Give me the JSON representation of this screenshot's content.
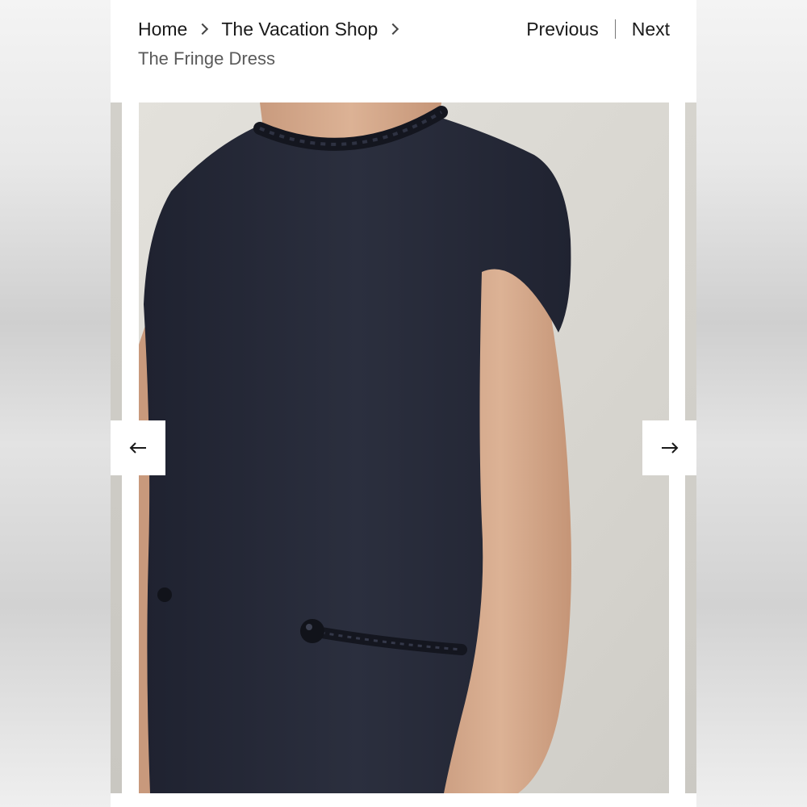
{
  "breadcrumb": {
    "home": "Home",
    "category": "The Vacation Shop",
    "current": "The Fringe Dress"
  },
  "pager": {
    "previous": "Previous",
    "next": "Next"
  },
  "gallery": {
    "image_subject": "Navy cap-sleeve dress with braided neckline and rope tie",
    "prev_icon": "arrow-left-icon",
    "next_icon": "arrow-right-icon"
  },
  "colors": {
    "dress": "#262a38",
    "skin": "#d6ab8f",
    "background": "#dcdad4"
  }
}
